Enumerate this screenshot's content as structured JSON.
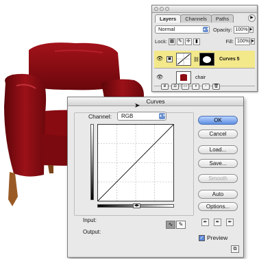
{
  "layers_palette": {
    "tabs": [
      "Layers",
      "Channels",
      "Paths"
    ],
    "active_tab": "Layers",
    "blend_mode": "Normal",
    "opacity_label": "Opacity:",
    "opacity_value": "100%",
    "lock_label": "Lock:",
    "fill_label": "Fill:",
    "fill_value": "100%",
    "layers": [
      {
        "name": "Curves 5",
        "selected": true,
        "visible": true
      },
      {
        "name": "chair",
        "selected": false,
        "visible": true
      }
    ]
  },
  "curves_dialog": {
    "title": "Curves",
    "channel_label": "Channel:",
    "channel_value": "RGB",
    "input_label": "Input:",
    "output_label": "Output:",
    "buttons": {
      "ok": "OK",
      "cancel": "Cancel",
      "load": "Load...",
      "save": "Save...",
      "smooth": "Smooth",
      "auto": "Auto",
      "options": "Options..."
    },
    "preview_label": "Preview",
    "preview_checked": true
  },
  "colors": {
    "chair_red": "#8b0d12",
    "selected_layer": "#f3e88a",
    "ok_button": "#5f8fe0"
  }
}
